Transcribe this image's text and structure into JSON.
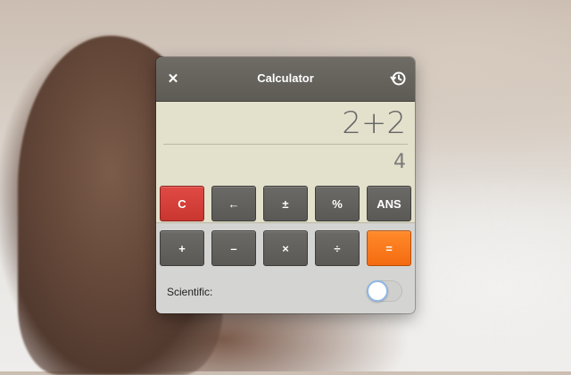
{
  "window": {
    "title": "Calculator",
    "close_glyph": "✕",
    "history_icon": "history-icon"
  },
  "display": {
    "expression": "2+2",
    "result": "4"
  },
  "keys": {
    "row1": [
      "C",
      "←",
      "±",
      "%",
      "ANS"
    ],
    "row2": [
      "+",
      "–",
      "×",
      "÷",
      "="
    ]
  },
  "scientific": {
    "label": "Scientific:",
    "enabled": false
  },
  "colors": {
    "clear_key": "#d9403a",
    "equals_key": "#f97b1c",
    "display_bg": "#e3e1cc"
  }
}
